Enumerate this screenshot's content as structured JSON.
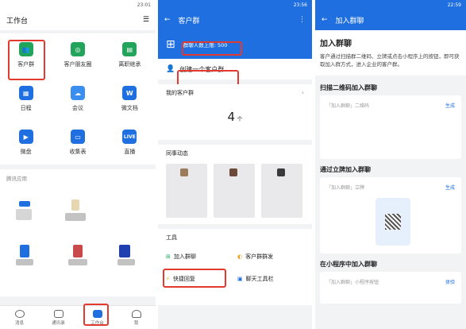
{
  "status": {
    "time1": "23:01",
    "time2": "23:56",
    "time3": "22:59"
  },
  "panel1": {
    "title": "工作台",
    "apps": [
      {
        "label": "客户群",
        "icon": "users-icon",
        "color": "#22a55a"
      },
      {
        "label": "客户朋友圈",
        "icon": "aperture-icon",
        "color": "#22a55a"
      },
      {
        "label": "离职继承",
        "icon": "document-icon",
        "color": "#22a55a"
      },
      {
        "label": "日程",
        "icon": "calendar-icon",
        "color": "#1f6fe0"
      },
      {
        "label": "会议",
        "icon": "cloud-icon",
        "color": "#1f6fe0"
      },
      {
        "label": "微文档",
        "icon": "w-icon",
        "color": "#1f6fe0"
      },
      {
        "label": "微盘",
        "icon": "play-icon",
        "color": "#1f6fe0"
      },
      {
        "label": "收集表",
        "icon": "form-icon",
        "color": "#1f6fe0"
      },
      {
        "label": "直播",
        "icon": "live-icon",
        "color": "#1f6fe0"
      }
    ],
    "section": "腾讯应用",
    "tabs": [
      "消息",
      "通讯录",
      "工作台",
      "我"
    ]
  },
  "panel2": {
    "title": "客户群",
    "limit": "群聊人数上限: 500",
    "create": "创建一个客户群",
    "mine_label": "我的客户群",
    "count": "4",
    "count_unit": "个",
    "moments": "同事动态",
    "tools": "工具",
    "tool_items": [
      "加入群聊",
      "客户群群发",
      "快捷回复",
      "聊天工具栏"
    ]
  },
  "panel3": {
    "title": "加入群聊",
    "heading": "加入群聊",
    "desc": "客户通过扫描群二维码、立牌或点击小程序上的按钮，即可获取加入群方式，进入企业的客户群。",
    "s1": "扫描二维码加入群聊",
    "s1_row": "「加入群聊」二维码",
    "s1_action": "生成",
    "s2": "通过立牌加入群聊",
    "s2_row": "「加入群聊」立牌",
    "s2_action": "生成",
    "s3": "在小程序中加入群聊",
    "s3_row": "「加入群聊」小程序按钮",
    "s3_action": "体验"
  }
}
